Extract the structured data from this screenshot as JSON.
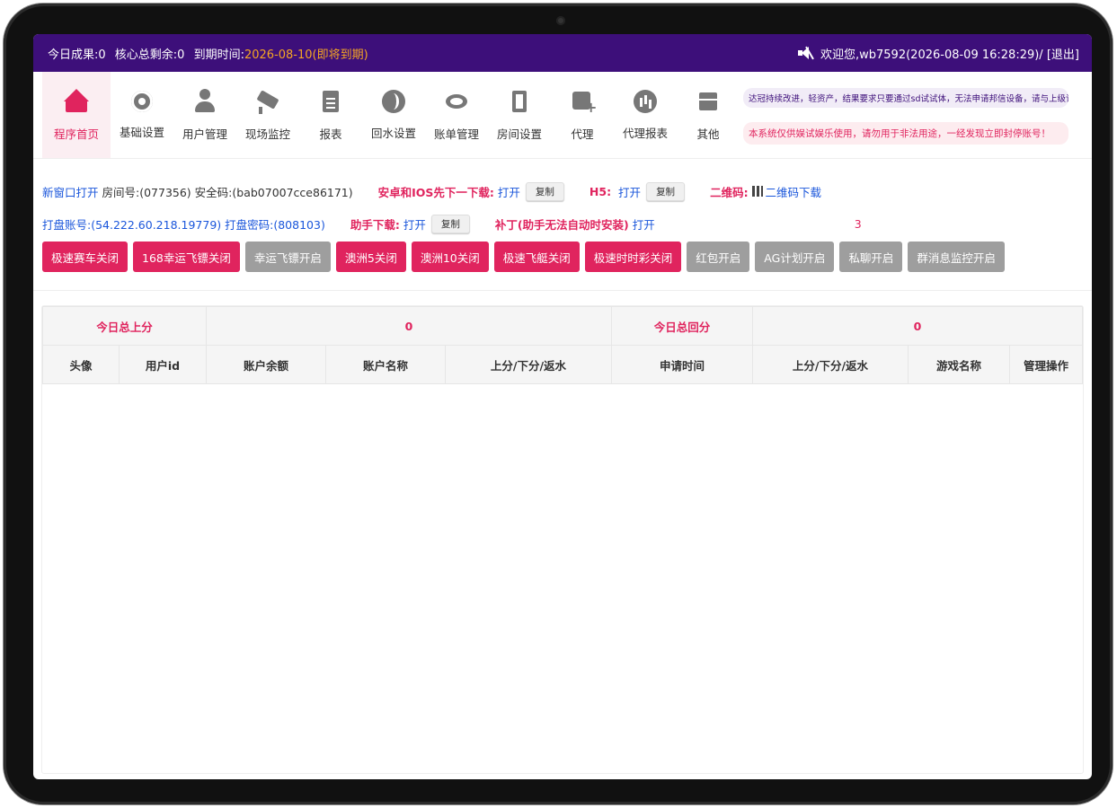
{
  "topbar": {
    "today_result": "今日成果:0",
    "core_remaining": "核心总剩余:0",
    "expire_label": "到期时间:",
    "expire_value": "2026-08-10(即将到期)",
    "welcome": "欢迎您,wb7592(2026-08-09 16:28:29)/",
    "logout": "[退出]"
  },
  "nav": {
    "items": [
      {
        "label": "程序首页",
        "icon": "home-icon"
      },
      {
        "label": "基础设置",
        "icon": "gear-icon"
      },
      {
        "label": "用户管理",
        "icon": "user-icon"
      },
      {
        "label": "现场监控",
        "icon": "camera-icon"
      },
      {
        "label": "报表",
        "icon": "clipboard-icon"
      },
      {
        "label": "回水设置",
        "icon": "swirl-icon"
      },
      {
        "label": "账单管理",
        "icon": "bill-icon"
      },
      {
        "label": "房间设置",
        "icon": "door-icon"
      },
      {
        "label": "代理",
        "icon": "agent-icon"
      },
      {
        "label": "代理报表",
        "icon": "chart-icon"
      },
      {
        "label": "其他",
        "icon": "box-icon"
      }
    ],
    "notice1": "达冠持续改进，轻资产，结果要求只要通过sd试试体，无法申请邦信设备，请与上级详细聊",
    "notice2": "本系统仅供娱试娱乐使用，请勿用于非法用途，一经发现立即封停账号！"
  },
  "info": {
    "new_window": "新窗口打开",
    "room_no": "房间号:(077356)",
    "security_code": "安全码:(bab07007cce86171)",
    "android_ios_label": "安卓和IOS先下一下载:",
    "open1": "打开",
    "copy1": "复制",
    "h5_label": "H5:",
    "open2": "打开",
    "copy2": "复制",
    "qr_label": "二维码:",
    "qr_download": "二维码下载",
    "dapan_account": "打盘账号:(54.222.60.218.19779)",
    "dapan_password": "打盘密码:(808103)",
    "helper_label": "助手下载:",
    "open3": "打开",
    "copy3": "复制",
    "patch_label": "补丁(助手无法自动时安装)",
    "open4": "打开",
    "count": "3"
  },
  "toggles": [
    {
      "label": "极速赛车关闭",
      "state": "on"
    },
    {
      "label": "168幸运飞镖关闭",
      "state": "on"
    },
    {
      "label": "幸运飞镖开启",
      "state": "off"
    },
    {
      "label": "澳洲5关闭",
      "state": "on"
    },
    {
      "label": "澳洲10关闭",
      "state": "on"
    },
    {
      "label": "极速飞艇关闭",
      "state": "on"
    },
    {
      "label": "极速时时彩关闭",
      "state": "on"
    },
    {
      "label": "红包开启",
      "state": "off"
    },
    {
      "label": "AG计划开启",
      "state": "off"
    },
    {
      "label": "私聊开启",
      "state": "off"
    },
    {
      "label": "群消息监控开启",
      "state": "off"
    }
  ],
  "table": {
    "summary": {
      "up_label": "今日总上分",
      "up_value": "0",
      "back_label": "今日总回分",
      "back_value": "0"
    },
    "headers": [
      "头像",
      "用户id",
      "账户余额",
      "账户名称",
      "上分/下分/返水",
      "申请时间",
      "上分/下分/返水",
      "游戏名称",
      "管理操作"
    ]
  },
  "colors": {
    "topbar": "#3d0f7a",
    "accent": "#e0245e",
    "link": "#1a56db",
    "off_button": "#9e9e9e"
  }
}
